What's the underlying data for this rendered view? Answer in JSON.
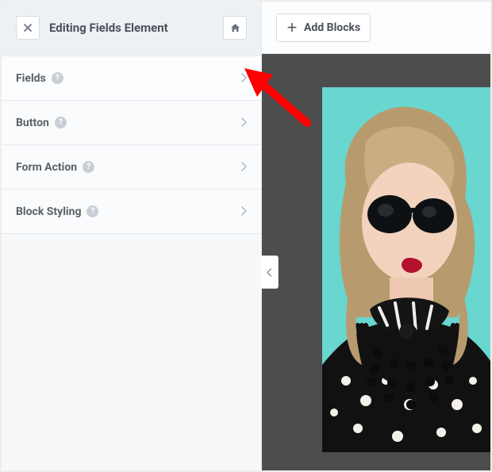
{
  "header": {
    "title": "Editing Fields Element"
  },
  "accordion": {
    "items": [
      {
        "label": "Fields"
      },
      {
        "label": "Button"
      },
      {
        "label": "Form Action"
      },
      {
        "label": "Block Styling"
      }
    ]
  },
  "preview": {
    "add_blocks_label": "Add Blocks"
  }
}
